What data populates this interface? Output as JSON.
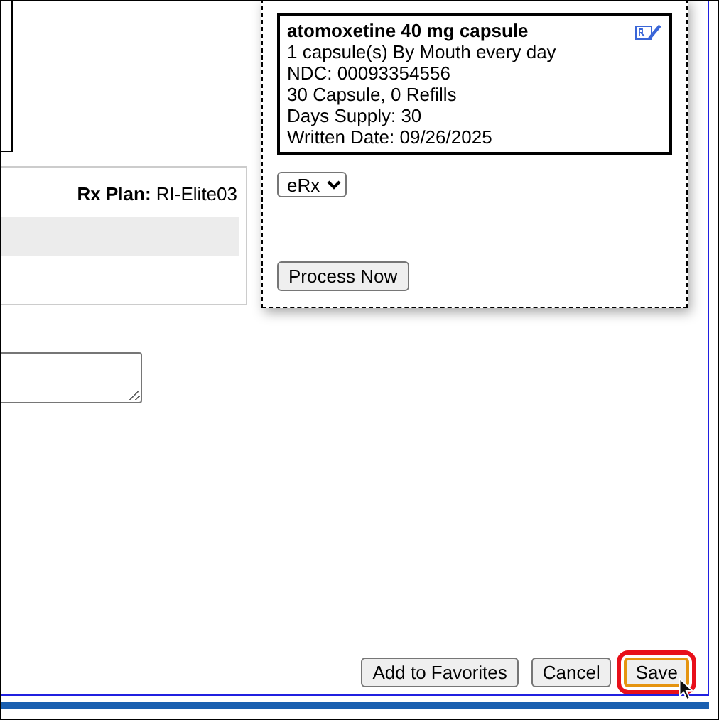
{
  "plan": {
    "label": "Rx Plan:",
    "value": "RI-Elite03"
  },
  "prescription_popup": {
    "drug": "atomoxetine 40 mg capsule",
    "details": [
      "1 capsule(s) By Mouth every day",
      "NDC: 00093354556",
      "30 Capsule, 0 Refills",
      "Days Supply: 30",
      "Written Date: 09/26/2025"
    ],
    "method": "eRx",
    "process_button": "Process Now"
  },
  "buttons": [
    {
      "label": "Add to Favorites",
      "focused": false,
      "highlighted": false
    },
    {
      "label": "Cancel",
      "focused": false,
      "highlighted": false
    },
    {
      "label": "Save",
      "focused": true,
      "highlighted": true
    }
  ]
}
